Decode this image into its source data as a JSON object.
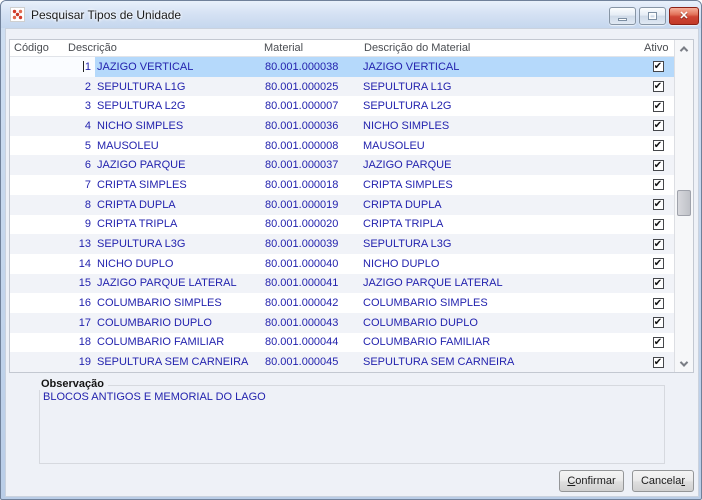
{
  "window": {
    "title": "Pesquisar Tipos de Unidade",
    "controls": {
      "minimize": "Minimizar",
      "maximize": "Maximizar",
      "close": "Fechar"
    }
  },
  "icons": {
    "app_icon": "red-dots-grid-logo",
    "close_glyph": "✕",
    "checkbox_checked_glyph": "✔",
    "scrollbar_up": "chevron-up",
    "scrollbar_down": "chevron-down"
  },
  "grid": {
    "columns": [
      {
        "key": "codigo",
        "label": "Código"
      },
      {
        "key": "descricao",
        "label": "Descrição"
      },
      {
        "key": "material",
        "label": "Material"
      },
      {
        "key": "descricao_material",
        "label": "Descrição do Material"
      },
      {
        "key": "ativo",
        "label": "Ativo"
      }
    ],
    "rows": [
      {
        "codigo": "1",
        "descricao": "JAZIGO VERTICAL",
        "material": "80.001.000038",
        "descricao_material": "JAZIGO VERTICAL",
        "ativo": true,
        "selected": true,
        "editing": true
      },
      {
        "codigo": "2",
        "descricao": "SEPULTURA L1G",
        "material": "80.001.000025",
        "descricao_material": "SEPULTURA L1G",
        "ativo": true
      },
      {
        "codigo": "3",
        "descricao": "SEPULTURA L2G",
        "material": "80.001.000007",
        "descricao_material": "SEPULTURA L2G",
        "ativo": true
      },
      {
        "codigo": "4",
        "descricao": "NICHO SIMPLES",
        "material": "80.001.000036",
        "descricao_material": "NICHO SIMPLES",
        "ativo": true
      },
      {
        "codigo": "5",
        "descricao": "MAUSOLEU",
        "material": "80.001.000008",
        "descricao_material": "MAUSOLEU",
        "ativo": true
      },
      {
        "codigo": "6",
        "descricao": "JAZIGO PARQUE",
        "material": "80.001.000037",
        "descricao_material": "JAZIGO PARQUE",
        "ativo": true
      },
      {
        "codigo": "7",
        "descricao": "CRIPTA SIMPLES",
        "material": "80.001.000018",
        "descricao_material": "CRIPTA SIMPLES",
        "ativo": true
      },
      {
        "codigo": "8",
        "descricao": "CRIPTA DUPLA",
        "material": "80.001.000019",
        "descricao_material": "CRIPTA DUPLA",
        "ativo": true
      },
      {
        "codigo": "9",
        "descricao": "CRIPTA TRIPLA",
        "material": "80.001.000020",
        "descricao_material": "CRIPTA TRIPLA",
        "ativo": true
      },
      {
        "codigo": "13",
        "descricao": "SEPULTURA L3G",
        "material": "80.001.000039",
        "descricao_material": "SEPULTURA L3G",
        "ativo": true
      },
      {
        "codigo": "14",
        "descricao": "NICHO DUPLO",
        "material": "80.001.000040",
        "descricao_material": "NICHO DUPLO",
        "ativo": true
      },
      {
        "codigo": "15",
        "descricao": "JAZIGO PARQUE LATERAL",
        "material": "80.001.000041",
        "descricao_material": "JAZIGO PARQUE LATERAL",
        "ativo": true
      },
      {
        "codigo": "16",
        "descricao": "COLUMBARIO SIMPLES",
        "material": "80.001.000042",
        "descricao_material": "COLUMBARIO SIMPLES",
        "ativo": true
      },
      {
        "codigo": "17",
        "descricao": "COLUMBARIO DUPLO",
        "material": "80.001.000043",
        "descricao_material": "COLUMBARIO DUPLO",
        "ativo": true
      },
      {
        "codigo": "18",
        "descricao": "COLUMBARIO FAMILIAR",
        "material": "80.001.000044",
        "descricao_material": "COLUMBARIO FAMILIAR",
        "ativo": true
      },
      {
        "codigo": "19",
        "descricao": "SEPULTURA SEM CARNEIRA",
        "material": "80.001.000045",
        "descricao_material": "SEPULTURA SEM CARNEIRA",
        "ativo": true
      }
    ]
  },
  "observacao": {
    "label": "Observação",
    "text": "BLOCOS ANTIGOS E MEMORIAL DO LAGO"
  },
  "actions": {
    "confirm": {
      "label": "Confirmar",
      "underline_index": 0
    },
    "cancel": {
      "label": "Cancelar",
      "underline_index": 7
    }
  },
  "colors": {
    "selection_bg": "#b5d9fb",
    "row_alt_bg": "#f1f3f8",
    "data_text": "#2323ae",
    "header_text": "#4a4d52",
    "client_bg": "#eef1f7",
    "close_button": "#cf4433"
  }
}
